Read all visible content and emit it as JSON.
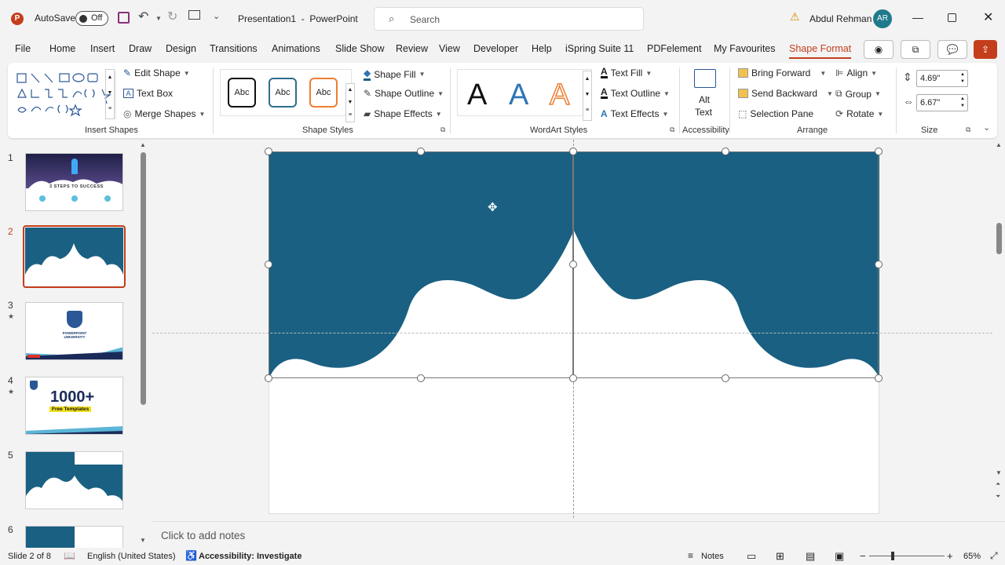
{
  "titlebar": {
    "autosave_label": "AutoSave",
    "autosave_state": "Off",
    "doc_title": "Presentation1  -  PowerPoint",
    "search_placeholder": "Search",
    "user_name": "Abdul Rehman",
    "user_initials": "AR"
  },
  "menu": {
    "tabs": [
      "File",
      "Home",
      "Insert",
      "Draw",
      "Design",
      "Transitions",
      "Animations",
      "Slide Show",
      "Review",
      "View",
      "Developer",
      "Help",
      "iSpring Suite 11",
      "PDFelement",
      "My Favourites",
      "Shape Format"
    ],
    "active": "Shape Format"
  },
  "ribbon": {
    "insert_shapes": {
      "label": "Insert Shapes",
      "edit_shape": "Edit Shape",
      "text_box": "Text Box",
      "merge_shapes": "Merge Shapes"
    },
    "shape_styles": {
      "label": "Shape Styles",
      "sample": "Abc",
      "shape_fill": "Shape Fill",
      "shape_outline": "Shape Outline",
      "shape_effects": "Shape Effects"
    },
    "wordart": {
      "label": "WordArt Styles",
      "sample": "A",
      "text_fill": "Text Fill",
      "text_outline": "Text Outline",
      "text_effects": "Text Effects"
    },
    "accessibility": {
      "label": "Accessibility",
      "alt_text_1": "Alt",
      "alt_text_2": "Text"
    },
    "arrange": {
      "label": "Arrange",
      "bring_forward": "Bring Forward",
      "send_backward": "Send Backward",
      "selection_pane": "Selection Pane",
      "align": "Align",
      "group": "Group",
      "rotate": "Rotate"
    },
    "size": {
      "label": "Size",
      "height": "4.69\"",
      "width": "6.67\""
    }
  },
  "slides": [
    {
      "num": "1",
      "title": "3 STEPS TO SUCCESS"
    },
    {
      "num": "2"
    },
    {
      "num": "3",
      "title": "POWERPOINT UNIVERSITY"
    },
    {
      "num": "4",
      "title": "1000+",
      "subtitle": "Free Templates"
    },
    {
      "num": "5"
    },
    {
      "num": "6"
    }
  ],
  "slide_pane_selected": "2",
  "notes_placeholder": "Click to add notes",
  "status": {
    "slide_info": "Slide 2 of 8",
    "language": "English (United States)",
    "accessibility": "Accessibility: Investigate",
    "notes": "Notes",
    "zoom": "65%"
  },
  "colors": {
    "shape_fill": "#1a6082",
    "accent": "#c43e1c",
    "wordart_blue": "#2e75b6",
    "wordart_orange": "#ed7d31"
  }
}
